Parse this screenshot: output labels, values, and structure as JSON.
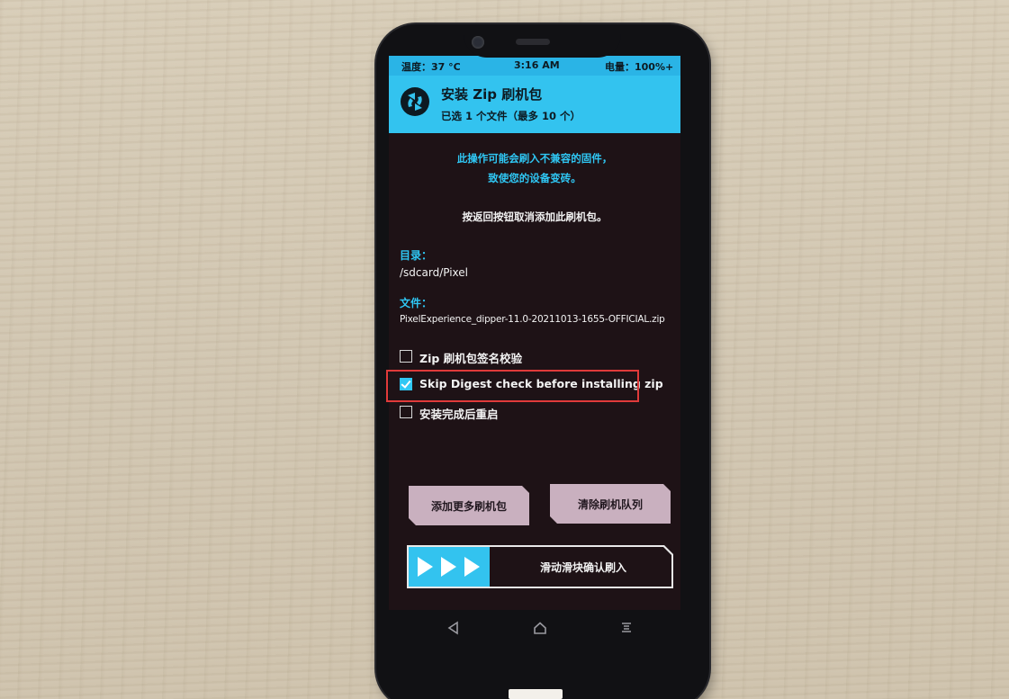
{
  "status": {
    "temperature": "温度：37 °C",
    "time": "3:16 AM",
    "battery": "电量：100%+"
  },
  "header": {
    "title": "安装 Zip 刷机包",
    "subtitle": "已选 1 个文件（最多 10 个）",
    "logo_icon": "twrp-logo-icon"
  },
  "warning": {
    "line1": "此操作可能会刷入不兼容的固件，",
    "line2": "致使您的设备变砖。"
  },
  "back_note": "按返回按钮取消添加此刷机包。",
  "folder": {
    "label": "目录：",
    "value": "/sdcard/Pixel"
  },
  "file": {
    "label": "文件：",
    "value": "PixelExperience_dipper-11.0-20211013-1655-OFFICIAL.zip"
  },
  "options": [
    {
      "label": "Zip 刷机包签名校验",
      "checked": false
    },
    {
      "label": "Skip Digest check before installing zip",
      "checked": true
    },
    {
      "label": "安装完成后重启",
      "checked": false
    }
  ],
  "buttons": {
    "add_more": "添加更多刷机包",
    "clear_queue": "清除刷机队列"
  },
  "slider": {
    "label": "滑动滑块确认刷入"
  },
  "nav": {
    "back_icon": "back-triangle-icon",
    "home_icon": "home-icon",
    "menu_icon": "menu-icon"
  },
  "colors": {
    "accent": "#33c3ef",
    "background": "#1e1216",
    "button": "#c9b0bf",
    "highlight": "#e03a3a"
  }
}
